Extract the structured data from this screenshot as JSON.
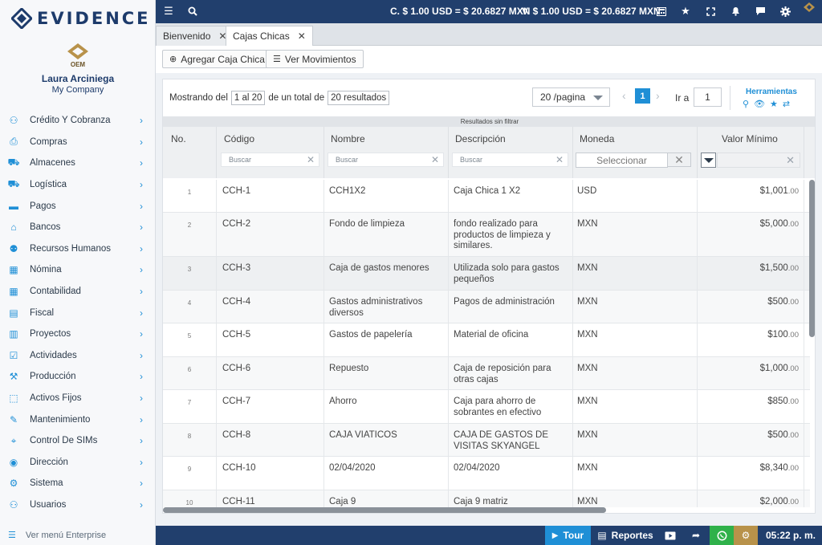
{
  "brand": {
    "name": "EVIDENCE"
  },
  "user": {
    "name": "Laura Arciniega",
    "company": "My Company",
    "avatar_text": "OEM"
  },
  "menu": [
    {
      "label": "Crédito Y Cobranza",
      "icon": "credit-icon"
    },
    {
      "label": "Compras",
      "icon": "purchases-icon"
    },
    {
      "label": "Almacenes",
      "icon": "warehouse-icon"
    },
    {
      "label": "Logística",
      "icon": "truck-icon"
    },
    {
      "label": "Pagos",
      "icon": "payments-icon"
    },
    {
      "label": "Bancos",
      "icon": "bank-icon"
    },
    {
      "label": "Recursos Humanos",
      "icon": "people-icon"
    },
    {
      "label": "Nómina",
      "icon": "payroll-icon"
    },
    {
      "label": "Contabilidad",
      "icon": "calculator-icon"
    },
    {
      "label": "Fiscal",
      "icon": "fiscal-icon"
    },
    {
      "label": "Proyectos",
      "icon": "projects-icon"
    },
    {
      "label": "Actividades",
      "icon": "checklist-icon"
    },
    {
      "label": "Producción",
      "icon": "production-icon"
    },
    {
      "label": "Activos Fijos",
      "icon": "assets-icon"
    },
    {
      "label": "Mantenimiento",
      "icon": "wrench-icon"
    },
    {
      "label": "Control De SIMs",
      "icon": "location-icon"
    },
    {
      "label": "Dirección",
      "icon": "direction-icon"
    },
    {
      "label": "Sistema",
      "icon": "system-icon"
    },
    {
      "label": "Usuarios",
      "icon": "user-icon"
    }
  ],
  "enterprise_label": "Ver menú Enterprise",
  "topbar": {
    "exchange_c": "C. $ 1.00 USD = $ 20.6827 MXN",
    "exchange_v": "V. $ 1.00 USD = $ 20.6827 MXN"
  },
  "tabs": [
    {
      "label": "Bienvenido",
      "active": false
    },
    {
      "label": "Cajas Chicas",
      "active": true
    }
  ],
  "toolbar": {
    "add_label": "Agregar Caja Chica",
    "movements_label": "Ver Movimientos"
  },
  "pager": {
    "showing_prefix": "Mostrando del",
    "range": "1 al 20",
    "total_prefix": "de un total de",
    "total": "20 resultados",
    "per_page": "20 /pagina",
    "current_page": "1",
    "goto_label": "Ir a",
    "goto_value": "1",
    "tools_label": "Herramientas"
  },
  "filter_status": "Resultados sin filtrar",
  "columns": {
    "no": "No.",
    "code": "Código",
    "name": "Nombre",
    "desc": "Descripción",
    "currency": "Moneda",
    "min": "Valor Mínimo"
  },
  "filters": {
    "search_placeholder": "Buscar",
    "select_placeholder": "Seleccionar"
  },
  "rows": [
    {
      "no": "1",
      "code": "CCH-1",
      "name": "CCH1X2",
      "desc": "Caja Chica 1 X2",
      "currency": "USD",
      "amount": "$1,001",
      "cents": ".00"
    },
    {
      "no": "2",
      "code": "CCH-2",
      "name": "Fondo de limpieza",
      "desc": "fondo realizado para productos de limpieza y similares.",
      "currency": "MXN",
      "amount": "$5,000",
      "cents": ".00"
    },
    {
      "no": "3",
      "code": "CCH-3",
      "name": "Caja de gastos menores",
      "desc": "Utilizada solo para gastos pequeños",
      "currency": "MXN",
      "amount": "$1,500",
      "cents": ".00"
    },
    {
      "no": "4",
      "code": "CCH-4",
      "name": "Gastos administrativos diversos",
      "desc": "Pagos de administración",
      "currency": "MXN",
      "amount": "$500",
      "cents": ".00"
    },
    {
      "no": "5",
      "code": "CCH-5",
      "name": "Gastos de papelería",
      "desc": "Material de oficina",
      "currency": "MXN",
      "amount": "$100",
      "cents": ".00"
    },
    {
      "no": "6",
      "code": "CCH-6",
      "name": "Repuesto",
      "desc": "Caja de reposición para otras cajas",
      "currency": "MXN",
      "amount": "$1,000",
      "cents": ".00"
    },
    {
      "no": "7",
      "code": "CCH-7",
      "name": "Ahorro",
      "desc": "Caja para ahorro de sobrantes en efectivo",
      "currency": "MXN",
      "amount": "$850",
      "cents": ".00"
    },
    {
      "no": "8",
      "code": "CCH-8",
      "name": "CAJA VIATICOS",
      "desc": "CAJA DE GASTOS DE VISITAS SKYANGEL",
      "currency": "MXN",
      "amount": "$500",
      "cents": ".00"
    },
    {
      "no": "9",
      "code": "CCH-10",
      "name": "02/04/2020",
      "desc": "02/04/2020",
      "currency": "MXN",
      "amount": "$8,340",
      "cents": ".00"
    },
    {
      "no": "10",
      "code": "CCH-11",
      "name": "Caja 9",
      "desc": "Caja 9 matriz",
      "currency": "MXN",
      "amount": "$2,000",
      "cents": ".00"
    }
  ],
  "bottombar": {
    "tour_label": "Tour",
    "reports_label": "Reportes",
    "time": "05:22 p. m."
  },
  "colors": {
    "navy": "#213f6d",
    "accent": "#1f8fd6",
    "gold": "#b8924a",
    "whatsapp": "#2fb14a"
  }
}
